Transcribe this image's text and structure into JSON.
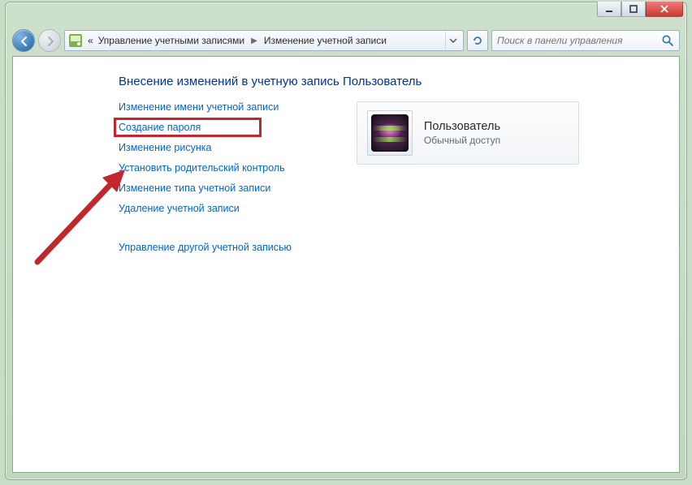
{
  "breadcrumb": {
    "level1_prefix": "«",
    "level1": "Управление учетными записями",
    "level2": "Изменение учетной записи"
  },
  "search": {
    "placeholder": "Поиск в панели управления"
  },
  "page": {
    "heading": "Внесение изменений в учетную запись Пользователь"
  },
  "links": {
    "change_name": "Изменение имени учетной записи",
    "create_password": "Создание пароля",
    "change_picture": "Изменение рисунка",
    "parental_controls": "Установить родительский контроль",
    "change_type": "Изменение типа учетной записи",
    "delete_account": "Удаление учетной записи",
    "manage_other": "Управление другой учетной записью"
  },
  "user": {
    "name": "Пользователь",
    "type": "Обычный доступ"
  },
  "icons": {
    "back": "◄",
    "forward": "►"
  }
}
